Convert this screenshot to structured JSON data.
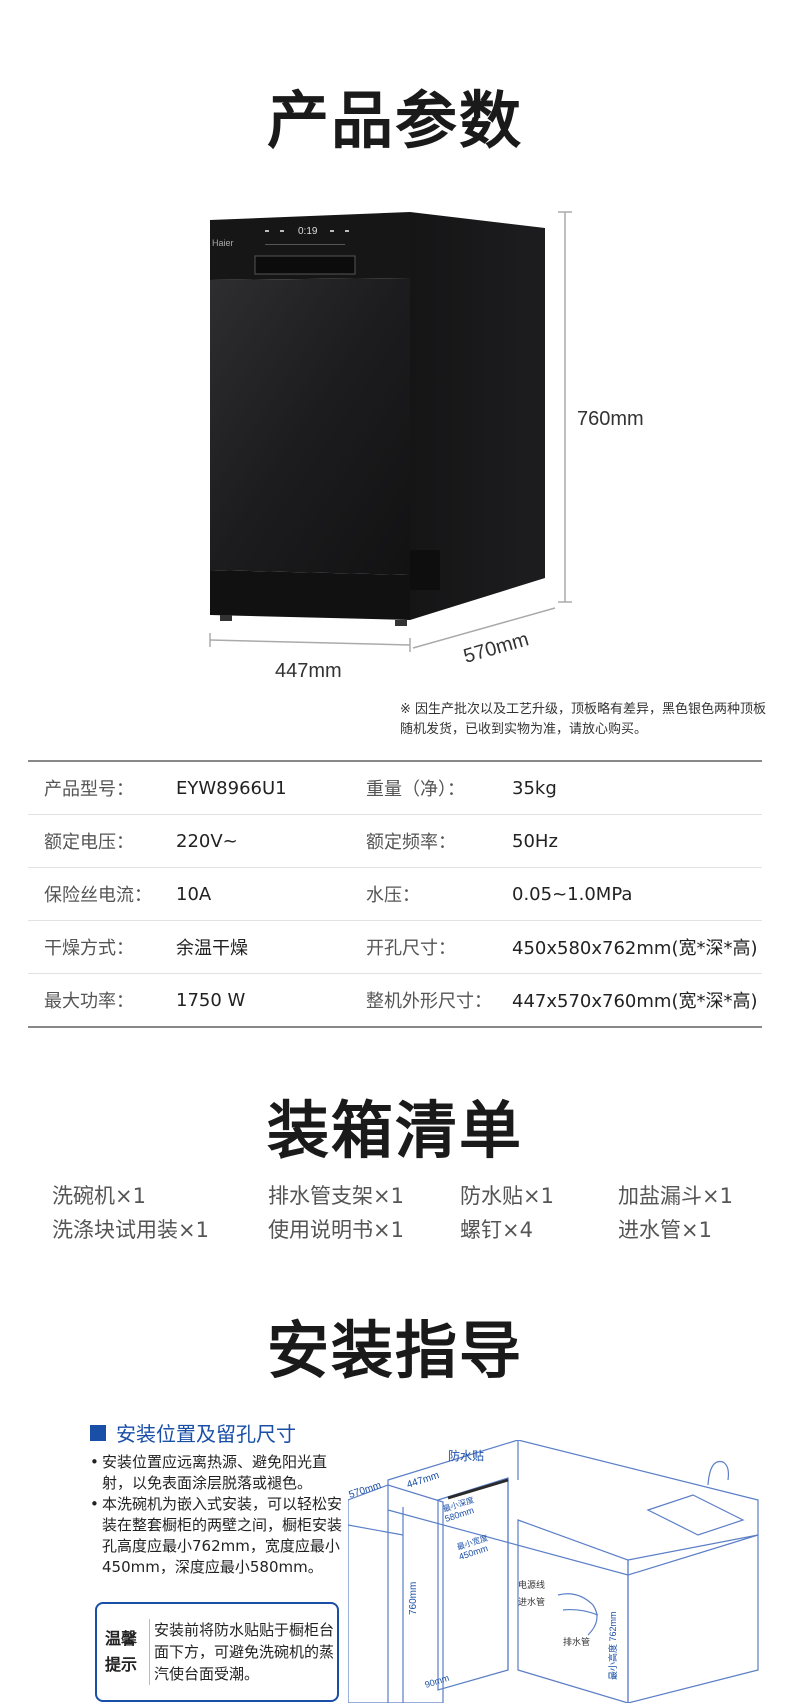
{
  "titles": {
    "params": "产品参数",
    "packing": "装箱清单",
    "install": "安装指导"
  },
  "product": {
    "brand": "Haier",
    "display": "0:19",
    "dim_height": "760mm",
    "dim_width": "447mm",
    "dim_depth": "570mm",
    "note": "※ 因生产批次以及工艺升级，顶板略有差异，黑色银色两种顶板随机发货，已收到实物为准，请放心购买。"
  },
  "specs": [
    {
      "l1": "产品型号：",
      "v1": "EYW8966U1",
      "l2": "重量（净）：",
      "v2": "35kg"
    },
    {
      "l1": "额定电压：",
      "v1": "220V~",
      "l2": "额定频率：",
      "v2": "50Hz"
    },
    {
      "l1": "保险丝电流：",
      "v1": "10A",
      "l2": "水压：",
      "v2": "0.05~1.0MPa"
    },
    {
      "l1": "干燥方式：",
      "v1": "余温干燥",
      "l2": "开孔尺寸：",
      "v2": "450x580x762mm(宽*深*高)"
    },
    {
      "l1": "最大功率：",
      "v1": "1750 W",
      "l2": "整机外形尺寸：",
      "v2": "447x570x760mm(宽*深*高)"
    }
  ],
  "packing": [
    "洗碗机×1",
    "排水管支架×1",
    "防水贴×1",
    "加盐漏斗×1",
    "洗涤块试用装×1",
    "使用说明书×1",
    "螺钉×4",
    "进水管×1"
  ],
  "install": {
    "subtitle": "安装位置及留孔尺寸",
    "bullet1": "安装位置应远离热源、避免阳光直射，以免表面涂层脱落或褪色。",
    "bullet2": "本洗碗机为嵌入式安装，可以轻松安装在整套橱柜的两壁之间，橱柜安装孔高度应最小762mm，宽度应最小450mm，深度应最小580mm。",
    "tip_tag1": "温馨",
    "tip_tag2": "提示",
    "tip_text": "安装前将防水贴贴于橱柜台面下方，可避免洗碗机的蒸汽使台面受潮。",
    "diagram": {
      "waterproof": "防水贴",
      "d570": "570mm",
      "d447": "447mm",
      "min_depth": "最小深度",
      "d580": "580mm",
      "min_width": "最小宽度",
      "d450": "450mm",
      "d760": "760mm",
      "d90": "90mm",
      "power_cord": "电源线",
      "inlet_hose": "进水管",
      "drain_hose": "排水管",
      "min_height": "最小高度 762mm"
    }
  },
  "colors": {
    "accent": "#1a4fa8",
    "machine": "#1b1b1d"
  }
}
